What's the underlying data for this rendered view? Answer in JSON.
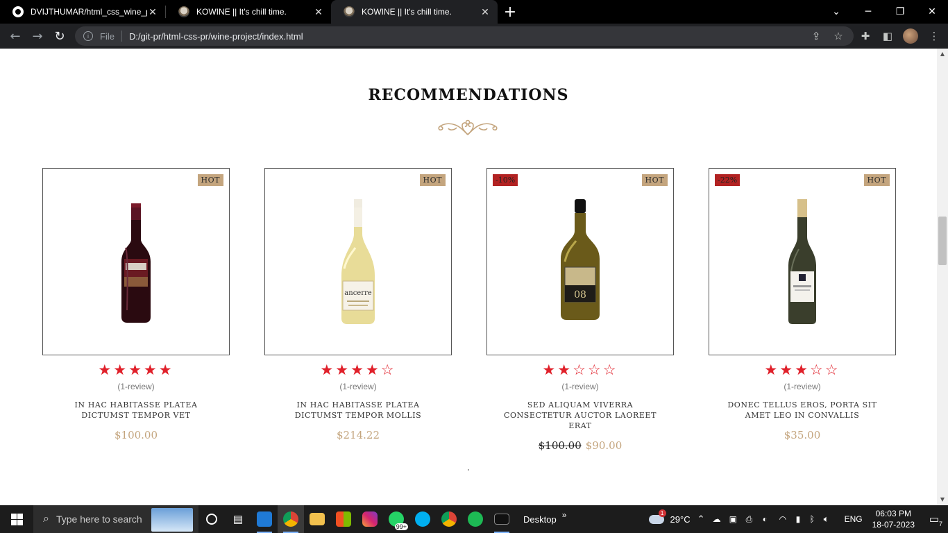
{
  "browser": {
    "tabs": [
      {
        "title": "DVIJTHUMAR/html_css_wine_pro",
        "favicon": "github-icon",
        "active": false
      },
      {
        "title": "KOWINE || It's chill time.",
        "favicon": "wine-icon",
        "active": false
      },
      {
        "title": "KOWINE || It's chill time.",
        "favicon": "wine-icon",
        "active": true
      }
    ],
    "new_tab": "+",
    "address": {
      "scheme_label": "File",
      "url": "D:/git-pr/html-css-pr/wine-project/index.html"
    }
  },
  "page": {
    "section_title": "RECOMMENDATIONS",
    "products": [
      {
        "hot": "HOT",
        "sale": "",
        "rating": 5,
        "reviews": "(1-review)",
        "name": "IN HAC HABITASSE PLATEA DICTUMST TEMPOR VET",
        "old_price": "",
        "price": "$100.00",
        "bottle": "red-wine-bottle"
      },
      {
        "hot": "HOT",
        "sale": "",
        "rating": 4,
        "reviews": "(1-review)",
        "name": "IN HAC HABITASSE PLATEA DICTUMST TEMPOR MOLLIS",
        "old_price": "",
        "price": "$214.22",
        "bottle": "white-wine-bottle"
      },
      {
        "hot": "HOT",
        "sale": "-10%",
        "rating": 2,
        "reviews": "(1-review)",
        "name": "SED ALIQUAM VIVERRA CONSECTETUR AUCTOR LAOREET ERAT",
        "old_price": "$100.00",
        "price": "$90.00",
        "bottle": "yellow-wine-bottle"
      },
      {
        "hot": "HOT",
        "sale": "-22%",
        "rating": 3,
        "reviews": "(1-review)",
        "name": "DONEC TELLUS EROS, PORTA SIT AMET LEO IN CONVALLIS",
        "old_price": "",
        "price": "$35.00",
        "bottle": "green-wine-bottle"
      }
    ],
    "colors": {
      "accent_gold": "#c4a57e",
      "star_red": "#e0202a",
      "sale_red": "#b22222"
    }
  },
  "taskbar": {
    "search_placeholder": "Type here to search",
    "desktop_label": "Desktop",
    "desktop_chevron": "»",
    "weather": "29°C",
    "weather_badge": "1",
    "language": "ENG",
    "time": "06:03 PM",
    "date": "18-07-2023",
    "whatsapp_badge": "99+",
    "notification_count": "7"
  }
}
